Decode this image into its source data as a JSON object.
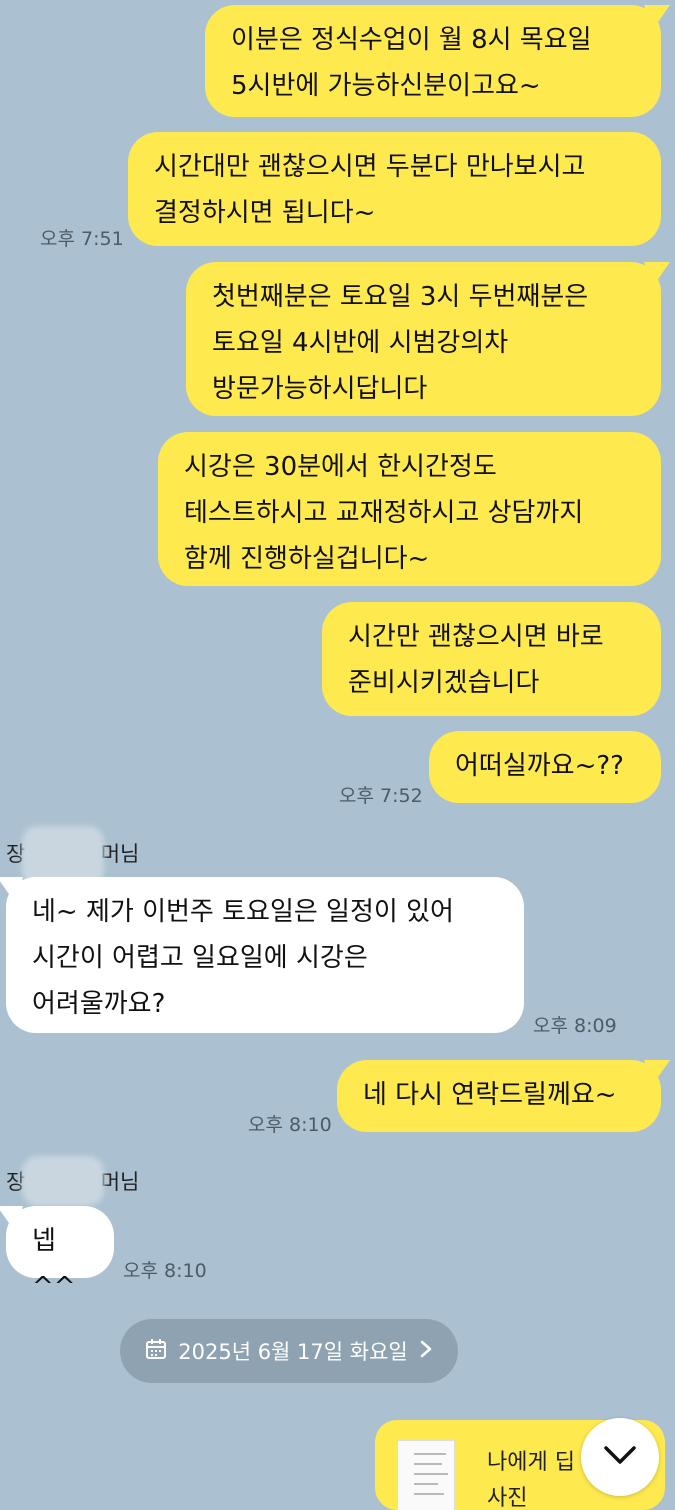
{
  "messages": [
    {
      "text": "이분은 정식수업이 월 8시 목요일\n5시반에 가능하신분이고요~"
    },
    {
      "text": "시간대만 괜찮으시면 두분다 만나보시고\n결정하시면 됩니다~"
    },
    {
      "text": "첫번째분은 토요일 3시 두번째분은\n토요일 4시반에 시범강의차\n방문가능하시답니다"
    },
    {
      "text": "시강은 30분에서 한시간정도\n테스트하시고 교재정하시고 상담까지\n함께 진행하실겁니다~"
    },
    {
      "text": "시간만 괜찮으시면 바로\n준비시키겠습니다"
    },
    {
      "text": "어떠실까요~??"
    },
    {
      "text": "네~ 제가 이번주 토요일은 일정이 있어\n시간이 어렵고 일요일에 시강은\n어려울까요?"
    },
    {
      "text": "네 다시 연락드릴께요~"
    },
    {
      "text": "넵^^"
    }
  ],
  "times": [
    "오후 7:51",
    "오후 7:52",
    "오후 8:09",
    "오후 8:10",
    "오후 8:10"
  ],
  "senders": [
    {
      "prefix": "장",
      "suffix": "머님"
    },
    {
      "prefix": "장",
      "suffix": "머님"
    }
  ],
  "date_divider": {
    "label": "2025년 6월 17일 화요일",
    "icon": "calendar-icon",
    "chevron": "chevron-right-icon"
  },
  "shared_card": {
    "title": "나에게 딥",
    "subtitle": "사진"
  },
  "scroll_button": {
    "icon": "chevron-down-icon"
  },
  "colors": {
    "background": "#abc1d1",
    "my_bubble": "#fee94f",
    "their_bubble": "#ffffff",
    "date_pill": "#8fa2b1"
  }
}
